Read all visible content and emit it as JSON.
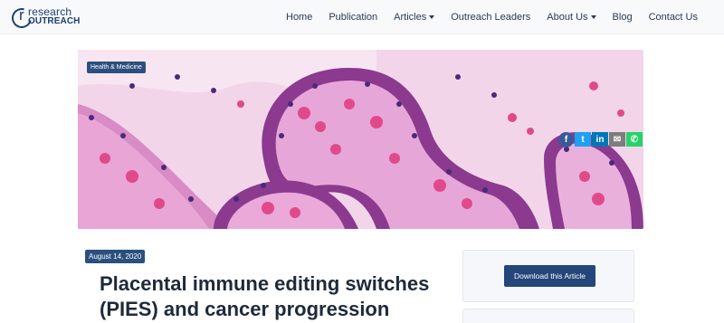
{
  "brand": {
    "logo_line1": "research",
    "logo_line2": "OUTREACH",
    "logo_letter": "r"
  },
  "nav": {
    "home": "Home",
    "publication": "Publication",
    "articles": "Articles",
    "outreach_leaders": "Outreach Leaders",
    "about_us": "About Us",
    "blog": "Blog",
    "contact_us": "Contact Us"
  },
  "hero": {
    "category_tag": "Health & Medicine"
  },
  "share": {
    "facebook": "f",
    "twitter": "t",
    "linkedin": "in",
    "email": "✉",
    "whatsapp": "✆"
  },
  "article": {
    "date": "August 14, 2020",
    "title": "Placental immune editing switches (PIES) and cancer progression"
  },
  "sidebar": {
    "download_label": "Download this Article"
  },
  "colors": {
    "brand_navy": "#1f3e73",
    "button_blue": "#24467a",
    "tag_blue": "#2b4f7e"
  }
}
